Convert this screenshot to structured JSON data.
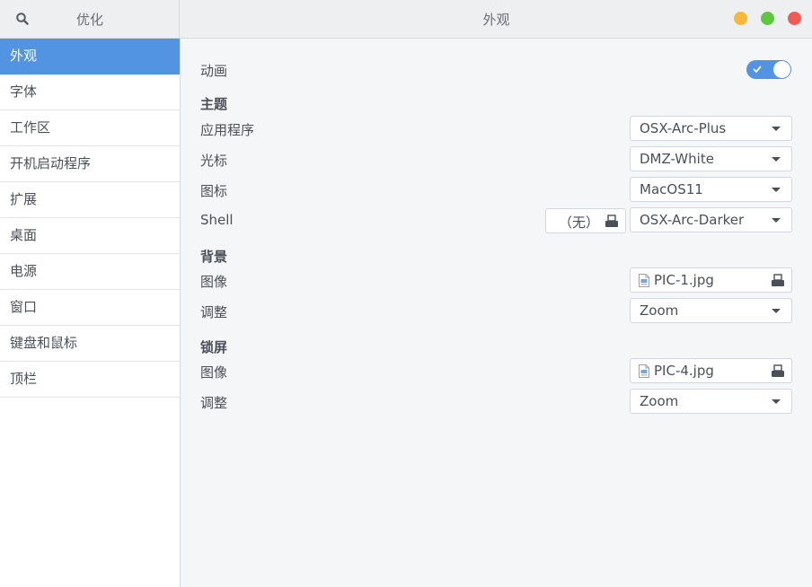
{
  "header": {
    "sidebar_title": "优化",
    "title": "外观",
    "search_icon": "search-icon",
    "window_colors": {
      "minimize": "#f6b73a",
      "maximize": "#5ec840",
      "close": "#f25a55"
    }
  },
  "sidebar": {
    "accent": "#5294e2",
    "items": [
      {
        "label": "外观",
        "active": true
      },
      {
        "label": "字体"
      },
      {
        "label": "工作区"
      },
      {
        "label": "开机启动程序"
      },
      {
        "label": "扩展"
      },
      {
        "label": "桌面"
      },
      {
        "label": "电源"
      },
      {
        "label": "窗口"
      },
      {
        "label": "键盘和鼠标"
      },
      {
        "label": "顶栏"
      }
    ]
  },
  "main": {
    "animation": {
      "label": "动画",
      "enabled": true
    },
    "themes": {
      "heading": "主题",
      "applications": {
        "label": "应用程序",
        "value": "OSX-Arc-Plus"
      },
      "cursor": {
        "label": "光标",
        "value": "DMZ-White"
      },
      "icons": {
        "label": "图标",
        "value": "MacOS11"
      },
      "shell": {
        "label": "Shell",
        "file_none": "（无）",
        "value": "OSX-Arc-Darker"
      }
    },
    "background": {
      "heading": "背景",
      "image": {
        "label": "图像",
        "file": "PIC-1.jpg"
      },
      "adjustment": {
        "label": "调整",
        "value": "Zoom"
      }
    },
    "lock_screen": {
      "heading": "锁屏",
      "image": {
        "label": "图像",
        "file": "PIC-4.jpg"
      },
      "adjustment": {
        "label": "调整",
        "value": "Zoom"
      }
    }
  }
}
